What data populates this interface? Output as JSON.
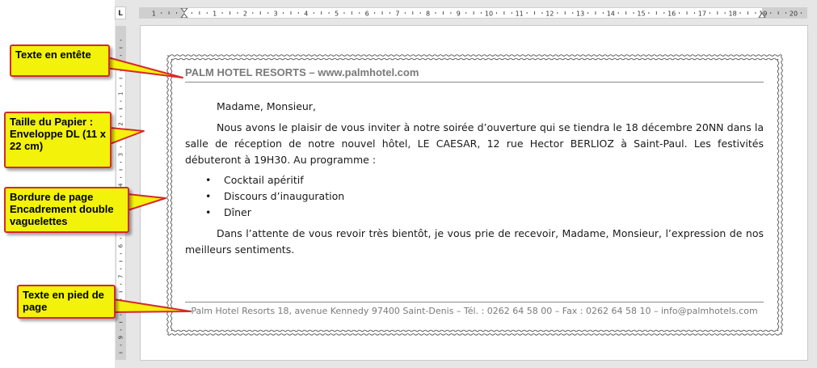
{
  "ruler": {
    "corner_glyph": "L",
    "horizontal_numbers": [
      "1",
      "2",
      "3",
      "4",
      "5",
      "6",
      "7",
      "8",
      "9",
      "10",
      "11",
      "12",
      "13",
      "14",
      "15",
      "16",
      "17",
      "18",
      "19",
      "20"
    ],
    "vertical_numbers": [
      "1",
      "2",
      "3",
      "4",
      "5",
      "6",
      "7",
      "8",
      "9"
    ]
  },
  "document": {
    "header": "PALM HOTEL RESORTS – www.palmhotel.com",
    "salutation": "Madame, Monsieur,",
    "paragraph1": "Nous avons le plaisir de vous inviter à notre soirée d’ouverture qui se tiendra le 18 décembre 20NN dans la salle de réception de notre nouvel hôtel, LE CAESAR, 12 rue Hector BERLIOZ à Saint-Paul. Les festivités débuteront à 19H30. Au programme :",
    "bullet_glyph": "•",
    "program": [
      "Cocktail apéritif",
      "Discours d’inauguration",
      "Dîner"
    ],
    "closing": "Dans l’attente de vous revoir très bientôt, je vous prie de recevoir, Madame, Monsieur, l’expression de nos meilleurs sentiments.",
    "footer": "Palm Hotel Resorts 18, avenue Kennedy 97400 Saint-Denis – Tél. : 0262 64 58 00 – Fax : 0262 64 58 10 – info@palmhotels.com"
  },
  "callouts": {
    "header": "Texte en entête",
    "paper": "Taille du Papier : Enveloppe DL (11 x 22 cm)",
    "border": "Bordure de page Encadrement double vaguelettes",
    "footer": "Texte en pied de page"
  },
  "colors": {
    "callout_fill": "#f2f20a",
    "callout_border": "#d42a2a",
    "header_footer_text": "#7a7a7a"
  },
  "icons": {
    "tab_selector": "left-tab-stop-icon",
    "first_line_indent": "hourglass-indent-marker-icon",
    "right_indent": "triangle-indent-marker-icon"
  }
}
